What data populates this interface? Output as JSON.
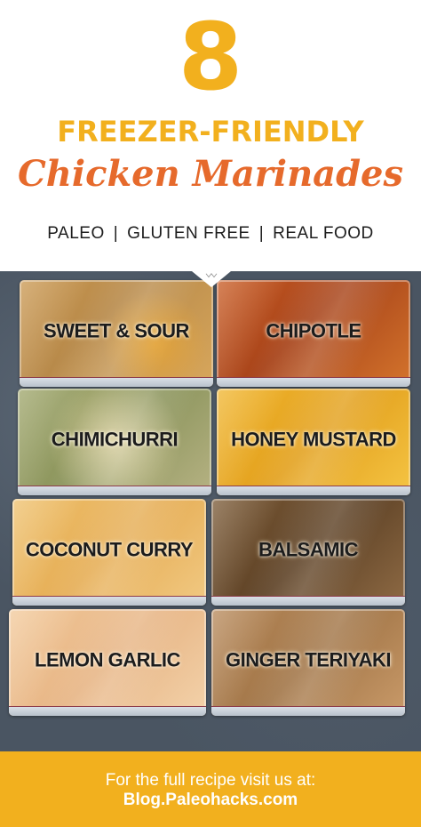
{
  "header": {
    "number": "8",
    "subtitle": "FREEZER-FRIENDLY",
    "title": "Chicken Marinades",
    "tags": [
      "PALEO",
      "GLUTEN FREE",
      "REAL FOOD"
    ],
    "tag_separator": "|"
  },
  "bags": [
    {
      "label": "SWEET & SOUR"
    },
    {
      "label": "CHIPOTLE"
    },
    {
      "label": "CHIMICHURRI"
    },
    {
      "label": "HONEY MUSTARD"
    },
    {
      "label": "COCONUT CURRY"
    },
    {
      "label": "BALSAMIC"
    },
    {
      "label": "LEMON GARLIC"
    },
    {
      "label": "GINGER TERIYAKI"
    }
  ],
  "footer": {
    "line1": "For the full recipe visit us at:",
    "line2": "Blog.Paleohacks.com"
  },
  "colors": {
    "accent_yellow": "#F2B01E",
    "accent_orange": "#E66A2C"
  }
}
